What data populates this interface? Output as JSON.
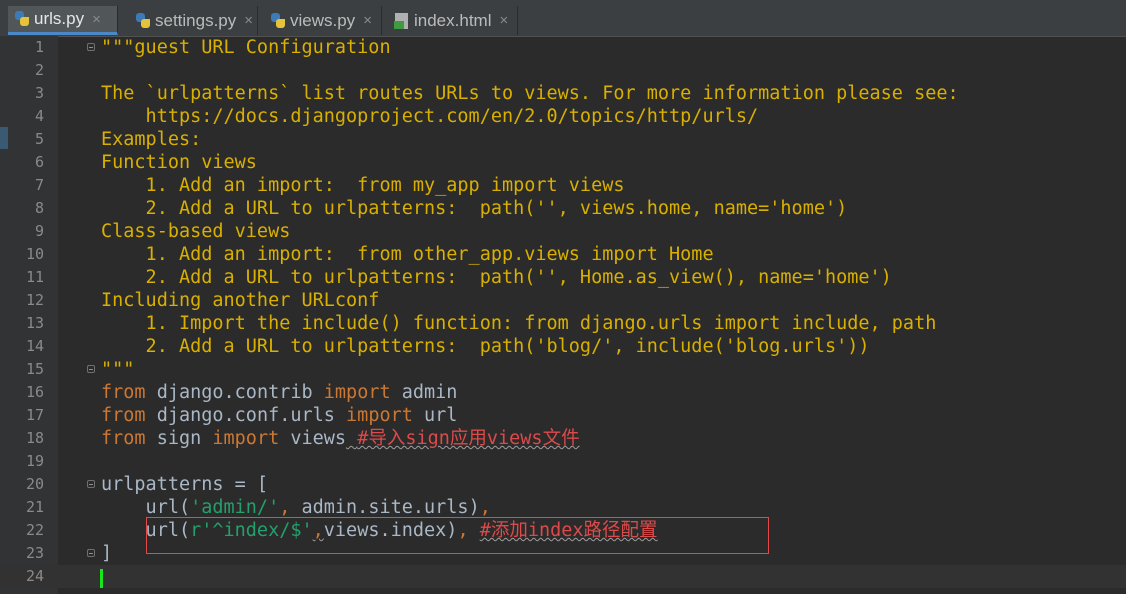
{
  "tabs": [
    {
      "label": "urls.py",
      "icon": "python-file-icon",
      "close": "×"
    },
    {
      "label": "settings.py",
      "icon": "python-file-icon",
      "close": "×"
    },
    {
      "label": "views.py",
      "icon": "python-file-icon",
      "close": "×"
    },
    {
      "label": "index.html",
      "icon": "html-file-icon",
      "close": "×"
    }
  ],
  "colors": {
    "docstring": "#d9b000",
    "keyword": "#cc7832",
    "string": "#23a06c",
    "comment": "#dd4a4a",
    "identifier": "#a9b7c6",
    "background": "#2b2b2b",
    "annotation_box": "#e54848"
  },
  "lines": [
    {
      "num": "1",
      "code": "\"\"\"guest URL Configuration"
    },
    {
      "num": "2",
      "code": ""
    },
    {
      "num": "3",
      "code": "The `urlpatterns` list routes URLs to views. For more information please see:"
    },
    {
      "num": "4",
      "code": "    https://docs.djangoproject.com/en/2.0/topics/http/urls/"
    },
    {
      "num": "5",
      "code": "Examples:"
    },
    {
      "num": "6",
      "code": "Function views"
    },
    {
      "num": "7",
      "code": "    1. Add an import:  from my_app import views"
    },
    {
      "num": "8",
      "code": "    2. Add a URL to urlpatterns:  path('', views.home, name='home')"
    },
    {
      "num": "9",
      "code": "Class-based views"
    },
    {
      "num": "10",
      "code": "    1. Add an import:  from other_app.views import Home"
    },
    {
      "num": "11",
      "code": "    2. Add a URL to urlpatterns:  path('', Home.as_view(), name='home')"
    },
    {
      "num": "12",
      "code": "Including another URLconf"
    },
    {
      "num": "13",
      "code": "    1. Import the include() function: from django.urls import include, path"
    },
    {
      "num": "14",
      "code": "    2. Add a URL to urlpatterns:  path('blog/', include('blog.urls'))"
    },
    {
      "num": "15",
      "code": "\"\"\""
    },
    {
      "num": "16",
      "code": "from django.contrib import admin"
    },
    {
      "num": "17",
      "code": "from django.conf.urls import url"
    },
    {
      "num": "18",
      "code": "from sign import views #导入sign应用views文件"
    },
    {
      "num": "19",
      "code": ""
    },
    {
      "num": "20",
      "code": "urlpatterns = ["
    },
    {
      "num": "21",
      "code": "    url('admin/', admin.site.urls),"
    },
    {
      "num": "22",
      "code": "    url(r'^index/$',views.index), #添加index路径配置"
    },
    {
      "num": "23",
      "code": "]"
    },
    {
      "num": "24",
      "code": ""
    }
  ]
}
